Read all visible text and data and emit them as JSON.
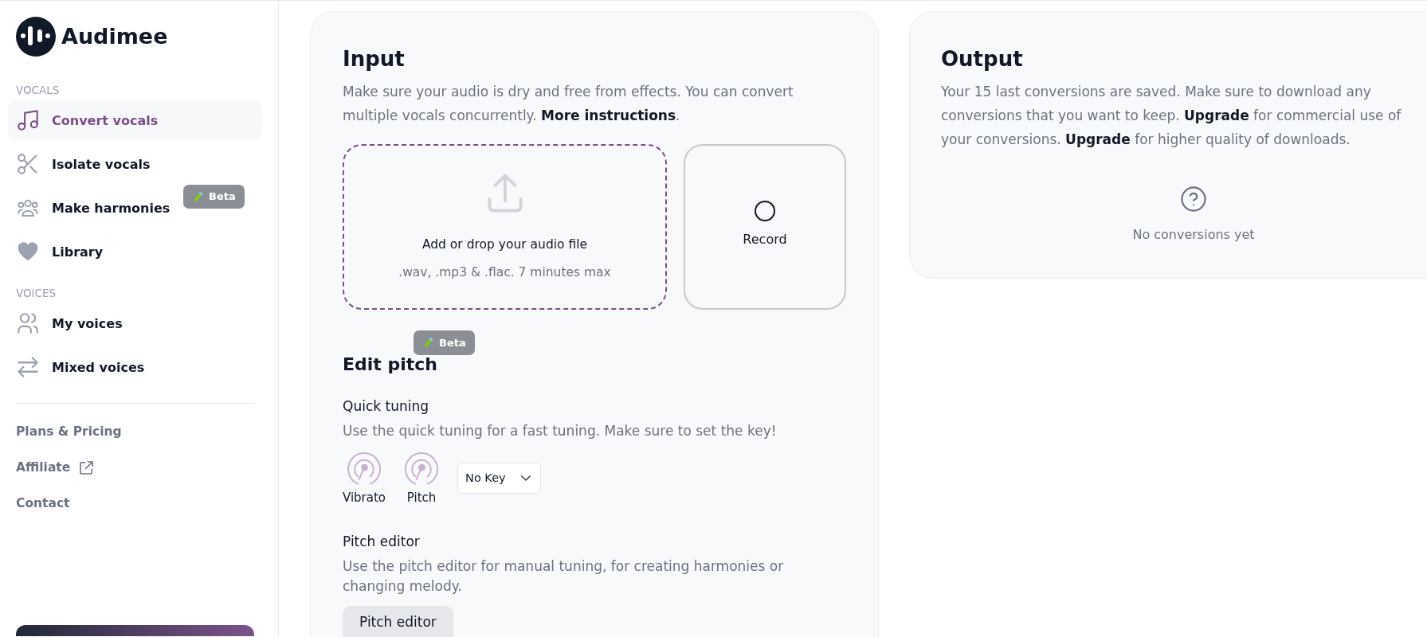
{
  "sidebar": {
    "logo": {
      "text": "Audimee"
    },
    "sections": [
      {
        "heading": "VOCALS",
        "items": [
          {
            "label": "Convert vocals",
            "selected": true
          },
          {
            "label": "Isolate vocals",
            "selected": false
          },
          {
            "label": "Make harmonies",
            "selected": false,
            "badge": "Beta"
          },
          {
            "label": "Library",
            "selected": false
          }
        ]
      },
      {
        "heading": "VOICES",
        "items": [
          {
            "label": "My voices",
            "selected": false
          },
          {
            "label": "Mixed voices",
            "selected": false
          }
        ]
      }
    ],
    "links": [
      {
        "label": "Plans & Pricing",
        "external": false
      },
      {
        "label": "Affiliate",
        "external": true
      },
      {
        "label": "Contact",
        "external": false
      }
    ]
  },
  "input": {
    "title": "Input",
    "description": [
      {
        "kind": "text",
        "text": "Make sure your audio is dry and free from effects. You can convert multiple vocals concurrently. "
      },
      {
        "kind": "link",
        "text": "More instructions"
      },
      {
        "kind": "text",
        "text": "."
      }
    ],
    "drop_zone": {
      "title": "Add or drop your audio file",
      "hint": ".wav, .mp3 & .flac. 7 minutes max"
    },
    "record_button": {
      "label": "Record"
    },
    "edit_pitch": {
      "title": "Edit pitch",
      "badge": "Beta",
      "quick_tuning": {
        "title": "Quick tuning",
        "description": "Use the quick tuning for a fast tuning. Make sure to set the key!",
        "toggles": [
          {
            "label": "Vibrato"
          },
          {
            "label": "Pitch"
          }
        ],
        "key_select": {
          "value": "No Key"
        }
      },
      "pitch_editor": {
        "title": "Pitch editor",
        "description": "Use the pitch editor for manual tuning, for creating harmonies or changing melody.",
        "button": "Pitch editor"
      }
    }
  },
  "output": {
    "title": "Output",
    "description": [
      {
        "kind": "text",
        "text": "Your 15 last conversions are saved. Make sure to download any conversions that you want to keep. "
      },
      {
        "kind": "link",
        "text": "Upgrade"
      },
      {
        "kind": "text",
        "text": " for commercial use of your conversions. "
      },
      {
        "kind": "link",
        "text": "Upgrade"
      },
      {
        "kind": "text",
        "text": " for higher quality of downloads."
      }
    ],
    "empty_state": {
      "message": "No conversions yet"
    }
  }
}
